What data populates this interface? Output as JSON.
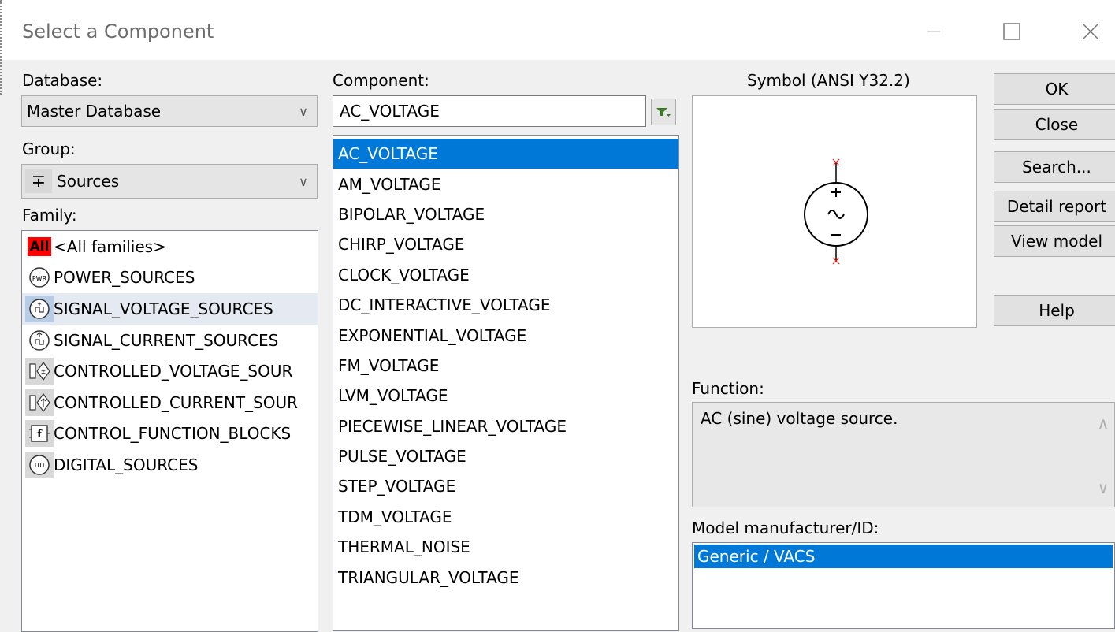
{
  "window": {
    "title": "Select a Component"
  },
  "database": {
    "label": "Database:",
    "value": "Master Database"
  },
  "group": {
    "label": "Group:",
    "value": "Sources",
    "icon": "plus-minus-icon"
  },
  "family": {
    "label": "Family:",
    "items": [
      {
        "label": "<All families>",
        "icon": "all-families-icon",
        "icon_text": "All"
      },
      {
        "label": "POWER_SOURCES",
        "icon": "power-source-icon",
        "icon_text": "PWR"
      },
      {
        "label": "SIGNAL_VOLTAGE_SOURCES",
        "icon": "signal-voltage-icon",
        "selected": true
      },
      {
        "label": "SIGNAL_CURRENT_SOURCES",
        "icon": "signal-current-icon"
      },
      {
        "label": "CONTROLLED_VOLTAGE_SOUR",
        "icon": "controlled-voltage-icon"
      },
      {
        "label": "CONTROLLED_CURRENT_SOUR",
        "icon": "controlled-current-icon"
      },
      {
        "label": "CONTROL_FUNCTION_BLOCKS",
        "icon": "function-block-icon",
        "icon_text": "f"
      },
      {
        "label": "DIGITAL_SOURCES",
        "icon": "digital-source-icon",
        "icon_text": "101"
      }
    ]
  },
  "component": {
    "label": "Component:",
    "value": "AC_VOLTAGE",
    "filter_icon": "filter-icon",
    "items": [
      {
        "label": "AC_VOLTAGE",
        "selected": true
      },
      {
        "label": "AM_VOLTAGE"
      },
      {
        "label": "BIPOLAR_VOLTAGE"
      },
      {
        "label": "CHIRP_VOLTAGE"
      },
      {
        "label": "CLOCK_VOLTAGE"
      },
      {
        "label": "DC_INTERACTIVE_VOLTAGE"
      },
      {
        "label": "EXPONENTIAL_VOLTAGE"
      },
      {
        "label": "FM_VOLTAGE"
      },
      {
        "label": "LVM_VOLTAGE"
      },
      {
        "label": "PIECEWISE_LINEAR_VOLTAGE"
      },
      {
        "label": "PULSE_VOLTAGE"
      },
      {
        "label": "STEP_VOLTAGE"
      },
      {
        "label": "TDM_VOLTAGE"
      },
      {
        "label": "THERMAL_NOISE"
      },
      {
        "label": "TRIANGULAR_VOLTAGE"
      }
    ]
  },
  "symbol": {
    "label": "Symbol (ANSI Y32.2)",
    "icon": "ac-voltage-source-symbol"
  },
  "buttons": {
    "ok": "OK",
    "close": "Close",
    "search": "Search...",
    "detail_report": "Detail report",
    "view_model": "View model",
    "help": "Help"
  },
  "function": {
    "label": "Function:",
    "text": "AC (sine) voltage source."
  },
  "model": {
    "label": "Model manufacturer/ID:",
    "items": [
      "Generic / VACS"
    ]
  },
  "colors": {
    "selection": "#0078d7",
    "selection_inactive": "#e5eaf2",
    "dialog_bg": "#f0f0f0"
  }
}
